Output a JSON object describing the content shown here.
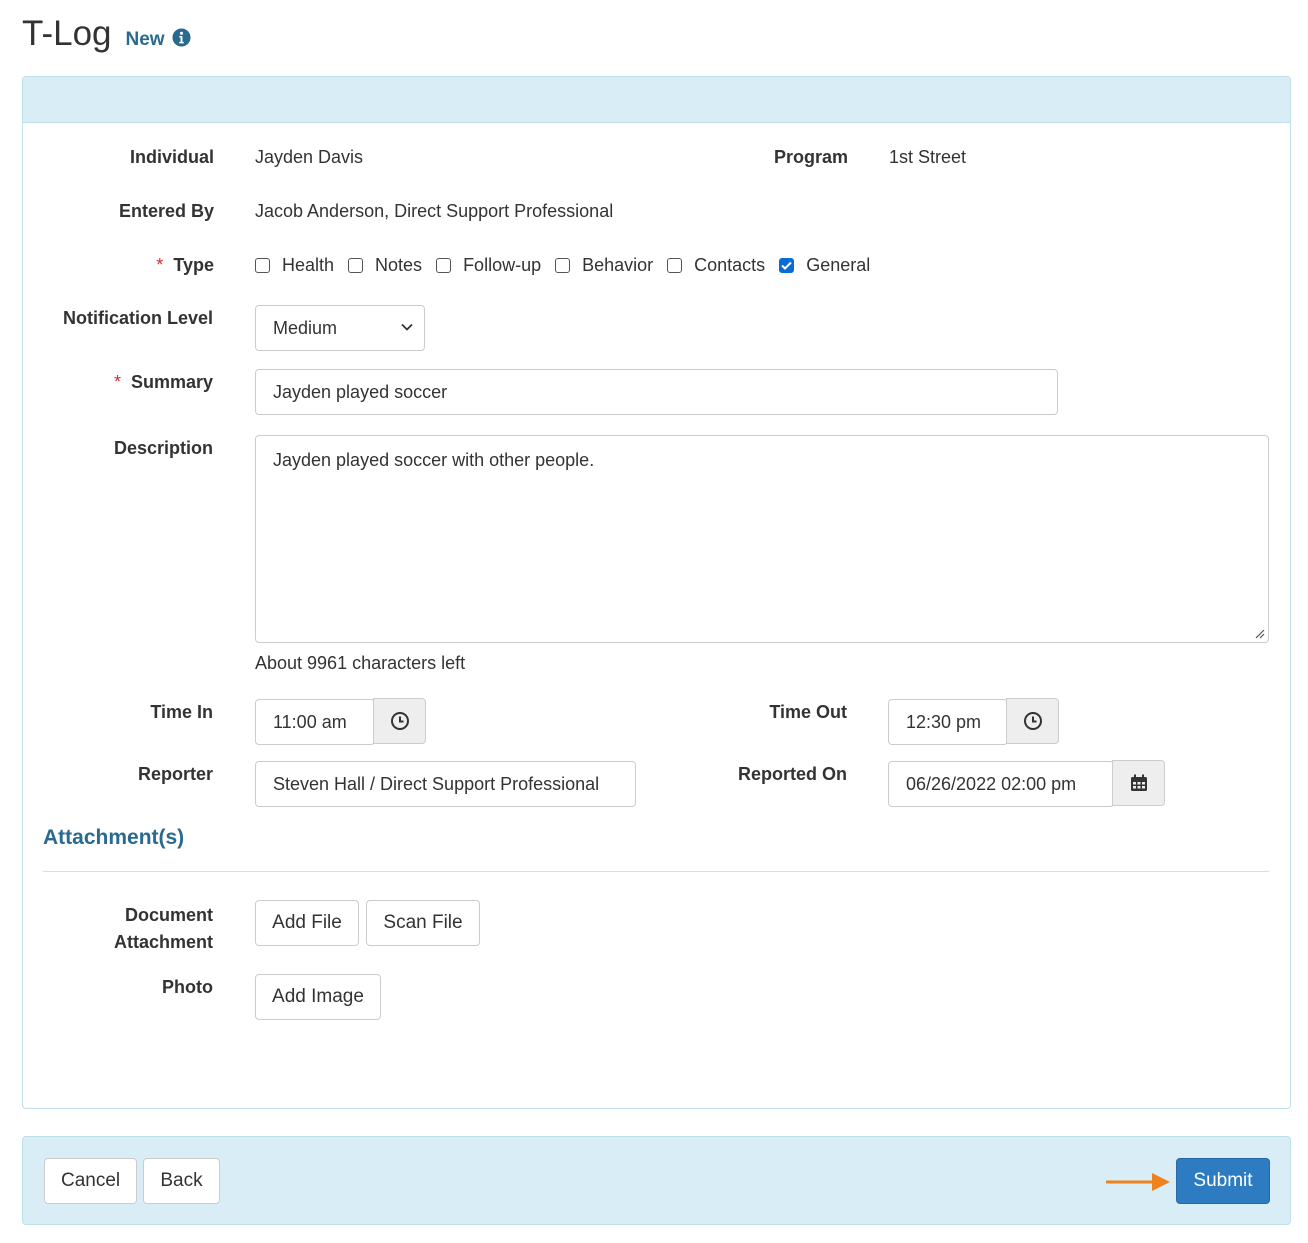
{
  "header": {
    "title": "T-Log",
    "subtitle": "New",
    "info_icon": "info-circle-icon"
  },
  "fields": {
    "individual": {
      "label": "Individual",
      "value": "Jayden Davis"
    },
    "program": {
      "label": "Program",
      "value": "1st Street"
    },
    "entered_by": {
      "label": "Entered By",
      "value": "Jacob Anderson, Direct Support Professional"
    },
    "type": {
      "required_mark": "*",
      "label": "Type",
      "options": [
        {
          "label": "Health",
          "checked": false
        },
        {
          "label": "Notes",
          "checked": false
        },
        {
          "label": "Follow-up",
          "checked": false
        },
        {
          "label": "Behavior",
          "checked": false
        },
        {
          "label": "Contacts",
          "checked": false
        },
        {
          "label": "General",
          "checked": true
        }
      ]
    },
    "notification_level": {
      "label": "Notification Level",
      "value": "Medium"
    },
    "summary": {
      "required_mark": "*",
      "label": "Summary",
      "value": "Jayden played soccer"
    },
    "description": {
      "label": "Description",
      "value": "Jayden played soccer with other people.",
      "helper": "About 9961 characters left"
    },
    "time_in": {
      "label": "Time In",
      "value": "11:00 am",
      "icon": "clock-icon"
    },
    "time_out": {
      "label": "Time Out",
      "value": "12:30 pm",
      "icon": "clock-icon"
    },
    "reporter": {
      "label": "Reporter",
      "value": "Steven Hall / Direct Support Professional"
    },
    "reported_on": {
      "label": "Reported On",
      "value": "06/26/2022 02:00 pm",
      "icon": "calendar-icon"
    }
  },
  "attachments": {
    "section_title": "Attachment(s)",
    "document_label_line1": "Document",
    "document_label_line2": "Attachment",
    "add_file": "Add File",
    "scan_file": "Scan File",
    "photo_label": "Photo",
    "add_image": "Add Image"
  },
  "footer": {
    "cancel": "Cancel",
    "back": "Back",
    "submit": "Submit",
    "arrow_icon": "arrow-right-icon",
    "arrow_color": "#f0821e",
    "submit_color": "#2d7cc1"
  }
}
